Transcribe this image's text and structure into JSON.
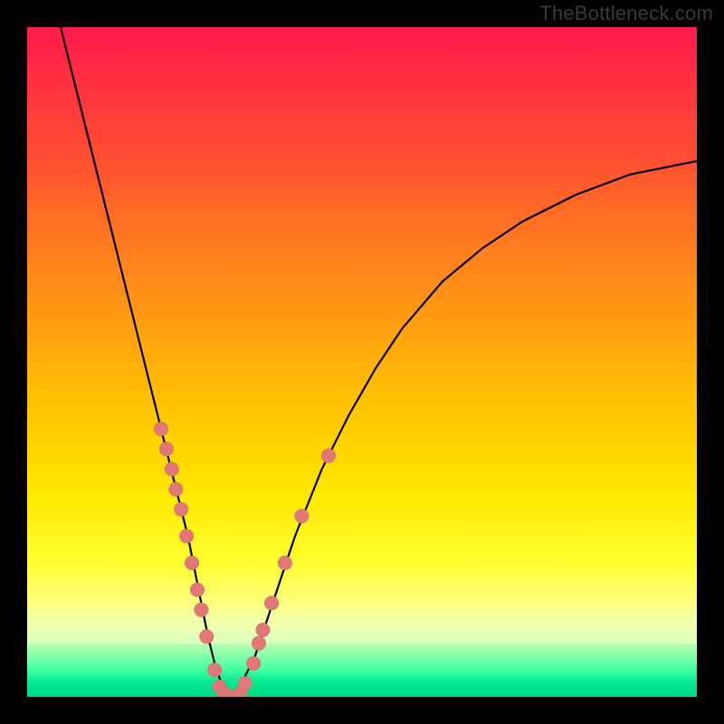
{
  "watermark": "TheBottleneck.com",
  "colors": {
    "curve": "#000000",
    "dot_fill": "#e07878"
  },
  "chart_data": {
    "type": "line",
    "title": "",
    "xlabel": "",
    "ylabel": "",
    "xlim": [
      0,
      100
    ],
    "ylim": [
      0,
      100
    ],
    "grid": false,
    "series": [
      {
        "name": "bottleneck-curve",
        "x": [
          5,
          8,
          11,
          14,
          17,
          20,
          22,
          24,
          26,
          27,
          28,
          29,
          30,
          31,
          32,
          34,
          36,
          38,
          40,
          44,
          48,
          52,
          56,
          62,
          68,
          74,
          82,
          90,
          100
        ],
        "y": [
          100,
          88,
          76,
          64,
          52,
          40,
          32,
          24,
          14,
          9,
          5,
          2,
          0,
          0,
          2,
          6,
          12,
          18,
          24,
          34,
          42,
          49,
          55,
          62,
          67,
          71,
          75,
          78,
          80
        ]
      }
    ],
    "scatter": {
      "name": "sample-points",
      "points": [
        {
          "x": 20.0,
          "y": 40
        },
        {
          "x": 20.8,
          "y": 37
        },
        {
          "x": 21.6,
          "y": 34
        },
        {
          "x": 22.2,
          "y": 31
        },
        {
          "x": 23.0,
          "y": 28
        },
        {
          "x": 23.8,
          "y": 24
        },
        {
          "x": 24.6,
          "y": 20
        },
        {
          "x": 25.4,
          "y": 16
        },
        {
          "x": 26.0,
          "y": 13
        },
        {
          "x": 26.8,
          "y": 9
        },
        {
          "x": 28.0,
          "y": 4
        },
        {
          "x": 28.7,
          "y": 1.5
        },
        {
          "x": 29.4,
          "y": 0.5
        },
        {
          "x": 30.2,
          "y": 0
        },
        {
          "x": 31.0,
          "y": 0
        },
        {
          "x": 31.8,
          "y": 0.5
        },
        {
          "x": 32.5,
          "y": 2
        },
        {
          "x": 33.8,
          "y": 5
        },
        {
          "x": 34.6,
          "y": 8
        },
        {
          "x": 35.2,
          "y": 10
        },
        {
          "x": 36.5,
          "y": 14
        },
        {
          "x": 38.5,
          "y": 20
        },
        {
          "x": 41.0,
          "y": 27
        },
        {
          "x": 45.0,
          "y": 36
        }
      ]
    },
    "dot_radius_px": 8
  }
}
